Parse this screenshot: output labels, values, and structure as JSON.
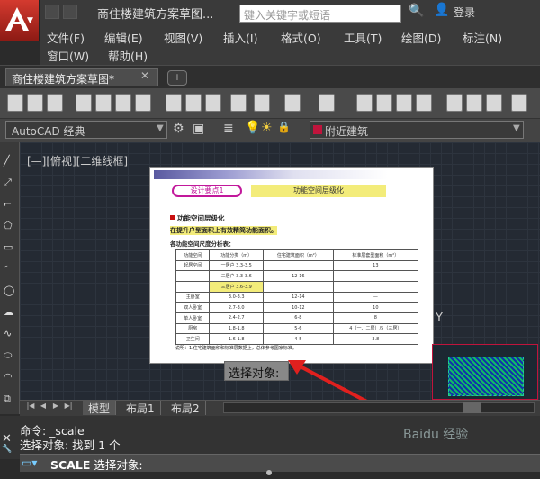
{
  "titlebar": {
    "doc_title": "商住楼建筑方案草图...",
    "search_placeholder": "键入关键字或短语",
    "login": "登录"
  },
  "menubar": {
    "items": [
      "文件(F)",
      "编辑(E)",
      "视图(V)",
      "插入(I)",
      "格式(O)",
      "工具(T)",
      "绘图(D)",
      "标注(N)",
      "窗口(W)",
      "帮助(H)"
    ]
  },
  "tabs": {
    "active": "商住楼建筑方案草图*"
  },
  "toolbar": {
    "workspace": "AutoCAD 经典",
    "layer": "附近建筑"
  },
  "viewport": {
    "label": "[—][俯视][二维线框]"
  },
  "drawing": {
    "badge": "设计要点1",
    "banner": "功能空间层级化",
    "subtitle": "功能空间层级化",
    "highlight": "在提升户型面积上有效精简功能面积。",
    "table_title": "各功能空间尺度分析表：",
    "table": [
      [
        "功能空间",
        "功能分类（m）",
        "住宅建筑面积（m²）",
        "标准层套型面积（m²）"
      ],
      [
        "起居空间",
        "一居户  3.3-3.5",
        "",
        "13"
      ],
      [
        "",
        "二居户  3.3-3.6",
        "12-16",
        ""
      ],
      [
        "",
        "三居户  3.6-3.9",
        "",
        ""
      ],
      [
        "主卧室",
        "3.0-3.3",
        "12-14",
        "—"
      ],
      [
        "双人卧室",
        "2.7-3.0",
        "10-12",
        "10"
      ],
      [
        "单人卧室",
        "2.4-2.7",
        "6-8",
        "8"
      ],
      [
        "厨房",
        "1.8-1.8",
        "5-6",
        "4（一、二居）/5（三居）"
      ],
      [
        "卫生间",
        "1.6-1.8",
        "4-5",
        "3.8"
      ]
    ],
    "note": "说明：1.住宅建筑面积和标准层数据上，总体参考国家标准。"
  },
  "tooltip": "选择对象:",
  "layout_tabs": [
    "模型",
    "布局1",
    "布局2"
  ],
  "command": {
    "line1": "命令: _scale",
    "line2": "选择对象: 找到 1 个",
    "prompt_cmd": "SCALE",
    "prompt_text": "选择对象:"
  },
  "watermark": "Baidu 经验",
  "colors": {
    "accent": "#c0143c",
    "highlight": "#f3ec7a",
    "badge": "#c2189b"
  }
}
